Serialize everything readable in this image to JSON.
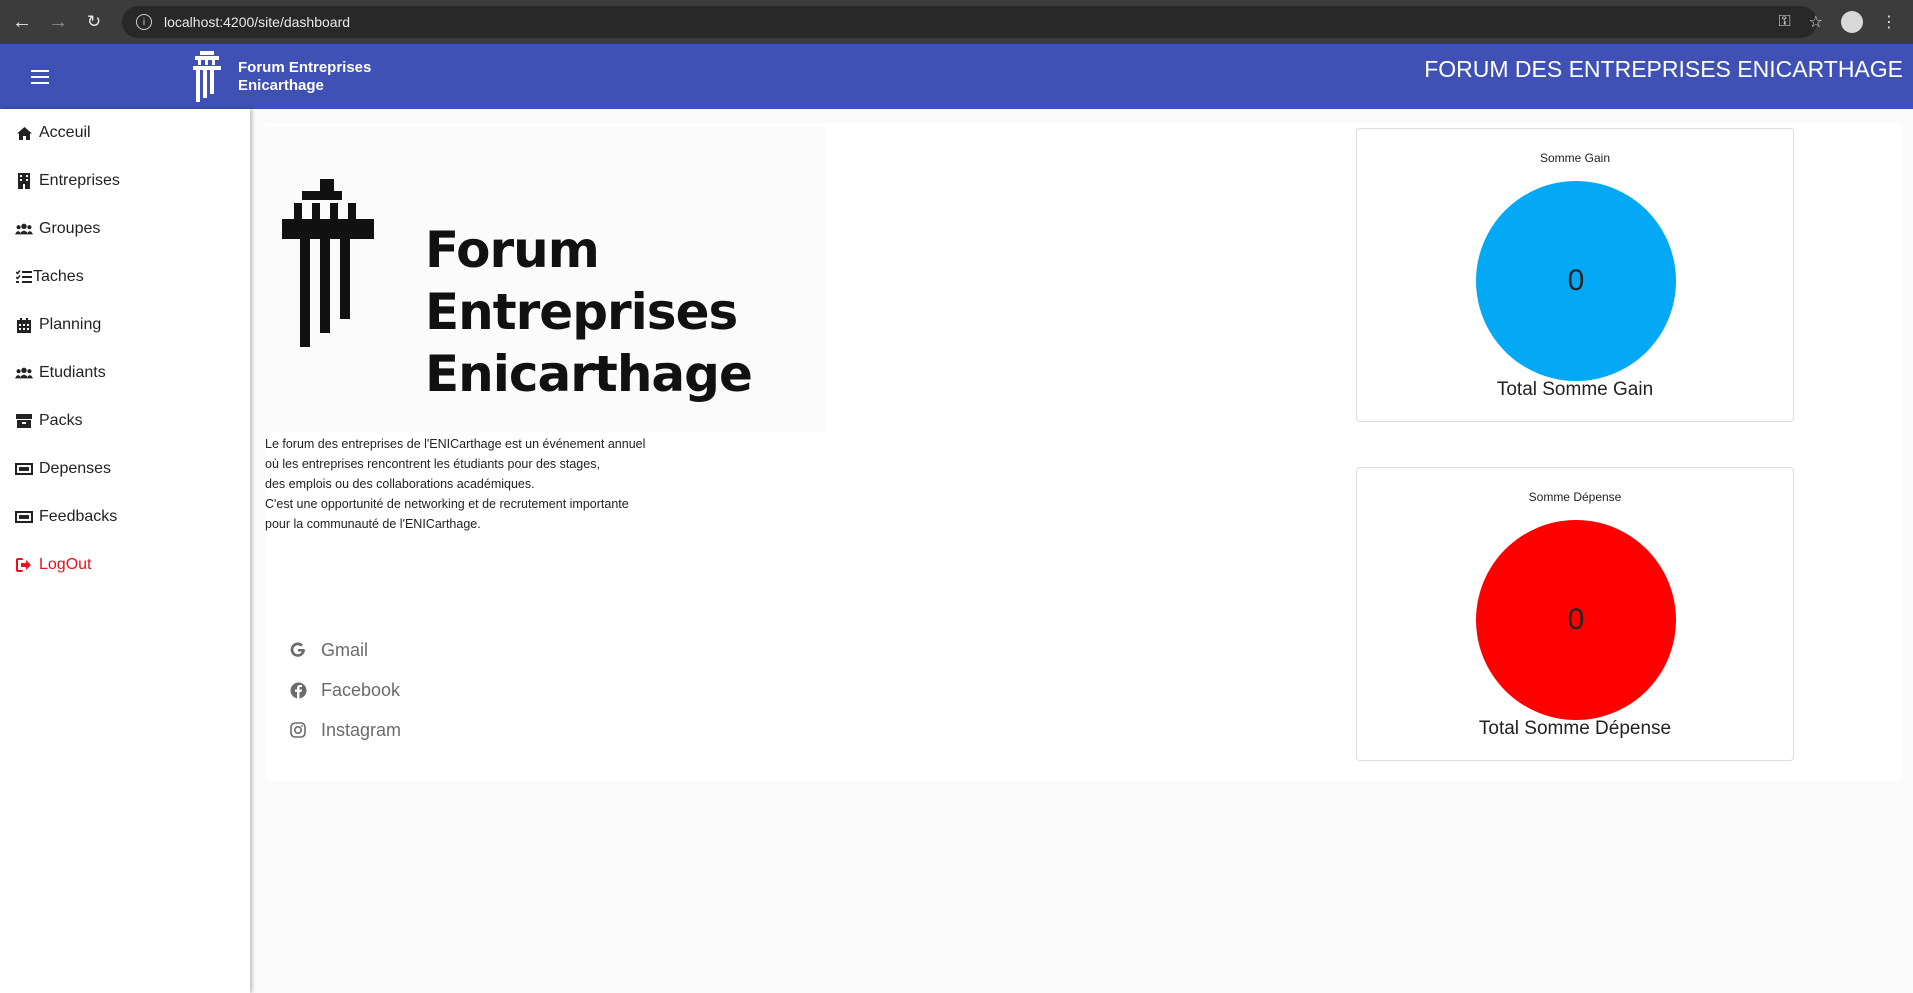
{
  "browser": {
    "url": "localhost:4200/site/dashboard",
    "info_icon": "info-icon"
  },
  "header": {
    "brand_line1": "Forum Entreprises",
    "brand_line2": "Enicarthage",
    "title": "FORUM DES ENTREPRISES ENICARTHAGE",
    "color": "#3f51b5"
  },
  "sidebar": {
    "items": [
      {
        "label": "Acceuil",
        "icon": "home-icon"
      },
      {
        "label": "Entreprises",
        "icon": "building-icon"
      },
      {
        "label": "Groupes",
        "icon": "users-icon"
      },
      {
        "label": "Taches",
        "icon": "tasks-icon"
      },
      {
        "label": "Planning",
        "icon": "calendar-icon"
      },
      {
        "label": "Etudiants",
        "icon": "users-icon"
      },
      {
        "label": "Packs",
        "icon": "box-icon"
      },
      {
        "label": "Depenses",
        "icon": "money-icon"
      },
      {
        "label": "Feedbacks",
        "icon": "money-icon"
      },
      {
        "label": "LogOut",
        "icon": "logout-icon",
        "color": "#e8121b"
      }
    ]
  },
  "main": {
    "logo_line1": "Forum Entreprises",
    "logo_line2": "Enicarthage",
    "description": [
      "Le forum des entreprises de l'ENICarthage est un événement annuel",
      "où les entreprises rencontrent les étudiants pour des stages,",
      "des emplois ou des collaborations académiques.",
      "C'est une opportunité de networking et de recrutement importante",
      "pour la communauté de l'ENICarthage."
    ],
    "socials": [
      {
        "label": "Gmail",
        "icon": "google-icon"
      },
      {
        "label": "Facebook",
        "icon": "facebook-icon"
      },
      {
        "label": "Instagram",
        "icon": "instagram-icon"
      }
    ]
  },
  "stats": {
    "gain": {
      "label": "Somme Gain",
      "value": "0",
      "total": "Total Somme Gain",
      "color": "#03a9f4"
    },
    "depense": {
      "label": "Somme Dépense",
      "value": "0",
      "total": "Total Somme Dépense",
      "color": "#ff0000"
    }
  }
}
